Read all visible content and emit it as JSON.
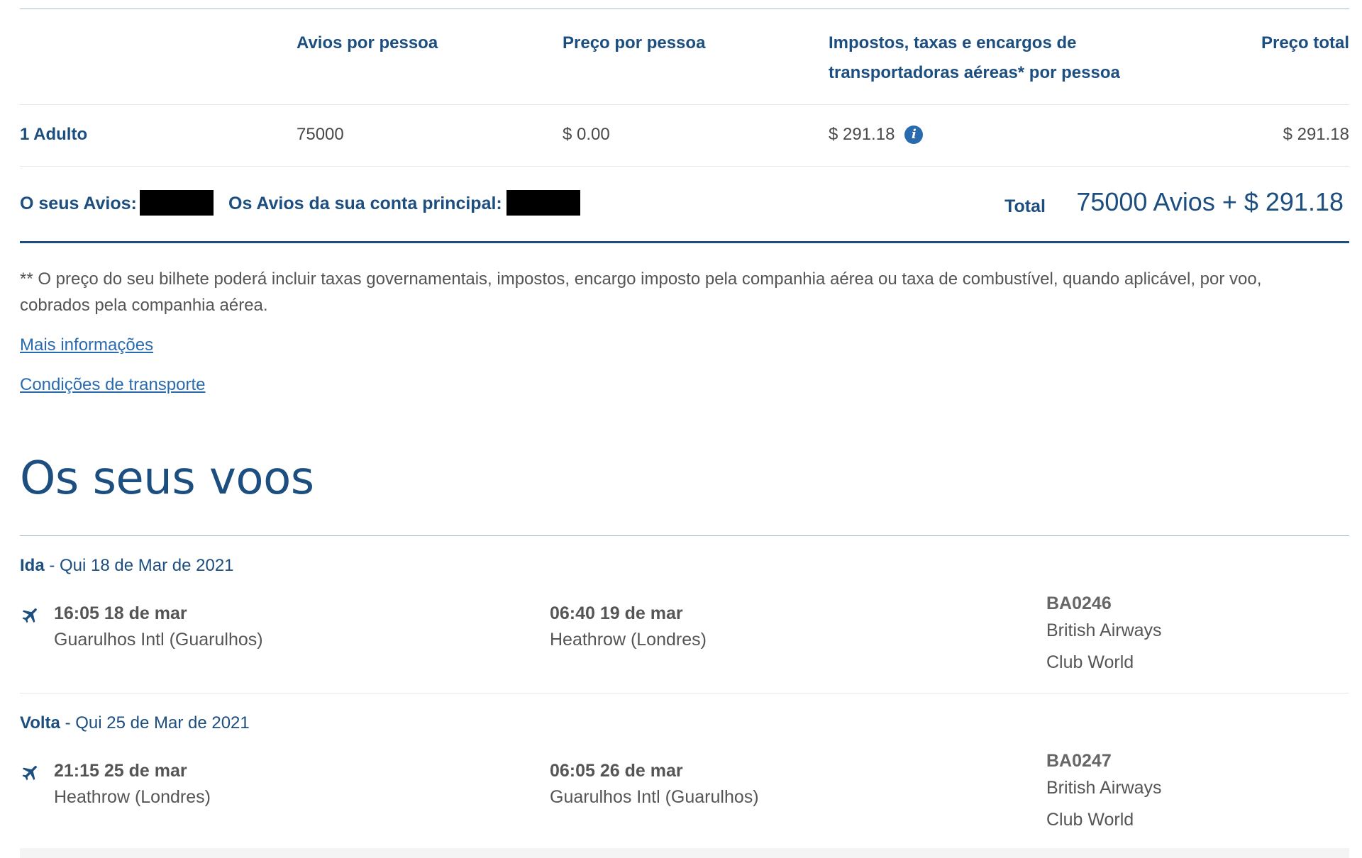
{
  "pricing": {
    "headers": {
      "avios": "Avios por pessoa",
      "price": "Preço por pessoa",
      "taxes_line1": "Impostos, taxas e encargos de",
      "taxes_line2": "transportadoras aéreas* por pessoa",
      "total": "Preço total"
    },
    "row": {
      "label": "1 Adulto",
      "avios": "75000",
      "price": "$ 0.00",
      "taxes": "$ 291.18",
      "total": "$ 291.18"
    },
    "info_icon": "info-icon",
    "your_avios_label": "O seus Avios:",
    "main_account_label": "Os Avios da sua conta principal:",
    "total_label": "Total",
    "total_value": "75000 Avios +  $ 291.18"
  },
  "footnote": {
    "line1": "** O preço do seu bilhete poderá incluir taxas governamentais, impostos, encargo imposto pela companhia aérea ou taxa de combustível, quando aplicável, por voo,",
    "line2": "cobrados pela companhia aérea."
  },
  "links": {
    "more_info": "Mais informações",
    "conditions": "Condições de transporte"
  },
  "flights": {
    "title": "Os seus voos",
    "legs": [
      {
        "type": "Ida",
        "date": " - Qui 18 de Mar de 2021",
        "dep_time": "16:05 18 de mar",
        "dep_airport": "Guarulhos Intl (Guarulhos)",
        "arr_time": "06:40 19 de mar",
        "arr_airport": "Heathrow (Londres)",
        "flight_no": "BA0246",
        "airline": "British Airways",
        "cabin": "Club World"
      },
      {
        "type": "Volta",
        "date": " - Qui 25 de Mar de 2021",
        "dep_time": "21:15 25 de mar",
        "dep_airport": "Heathrow (Londres)",
        "arr_time": "06:05 26 de mar",
        "arr_airport": "Guarulhos Intl (Guarulhos)",
        "flight_no": "BA0247",
        "airline": "British Airways",
        "cabin": "Club World"
      }
    ]
  },
  "colors": {
    "brand_blue": "#1c4e80",
    "link_blue": "#2a6bb0",
    "text_grey": "#555555"
  }
}
